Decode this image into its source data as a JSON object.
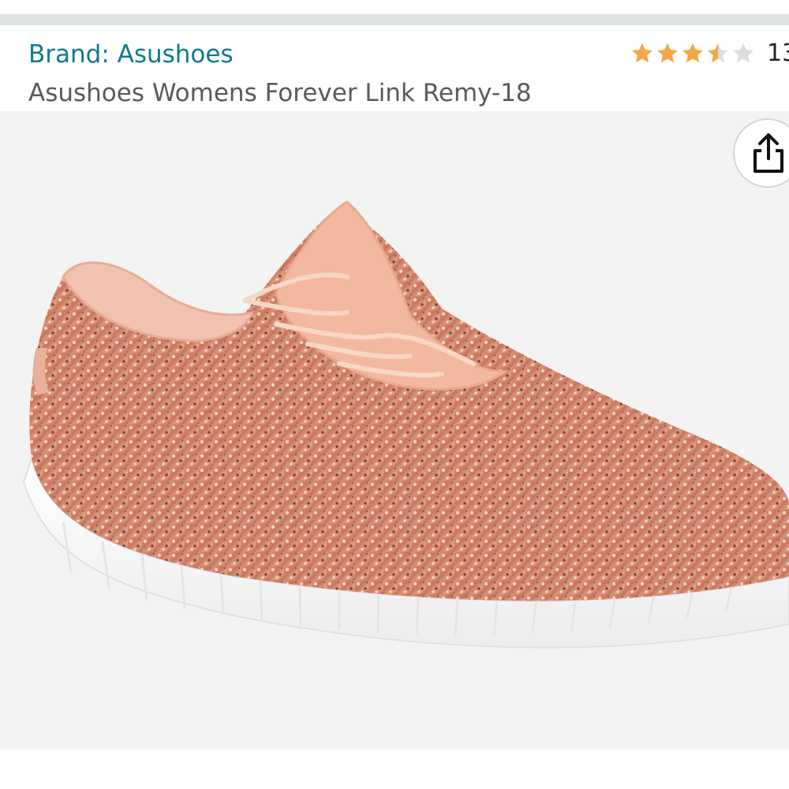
{
  "product": {
    "brand_link": "Brand: Asushoes",
    "title": "Asushoes Womens Forever Link Remy-18"
  },
  "rating": {
    "stars": 3.5,
    "max_stars": 5,
    "count_visible": "13",
    "star_color": "#f3a847",
    "empty_star_color": "#dddddd"
  },
  "share": {
    "icon": "share-icon"
  },
  "image": {
    "subject": "rose gold glitter sneaker",
    "background": "#f3f3f3"
  }
}
